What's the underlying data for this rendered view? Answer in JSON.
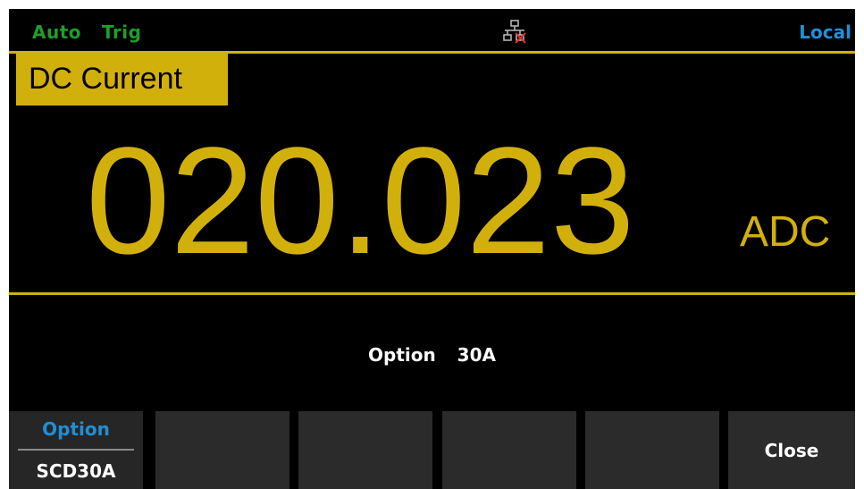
{
  "status_bar": {
    "trigger_mode": "Auto  Trig",
    "network_icon": "lan-disconnected-icon",
    "control_mode": "Local"
  },
  "measurement": {
    "function_label": "DC Current",
    "reading": "020.023",
    "unit": "ADC"
  },
  "message": "Option  30A",
  "softkeys": [
    {
      "label": "Option",
      "value": "SCD30A"
    },
    {
      "label": ""
    },
    {
      "label": ""
    },
    {
      "label": ""
    },
    {
      "label": ""
    },
    {
      "label": "Close"
    }
  ],
  "colors": {
    "background": "#000000",
    "accent_yellow": "#d2b00c",
    "status_green": "#1f9d2a",
    "status_blue": "#1f8fd6",
    "softkey_bg": "#2b2b2b",
    "text_white": "#ffffff"
  }
}
